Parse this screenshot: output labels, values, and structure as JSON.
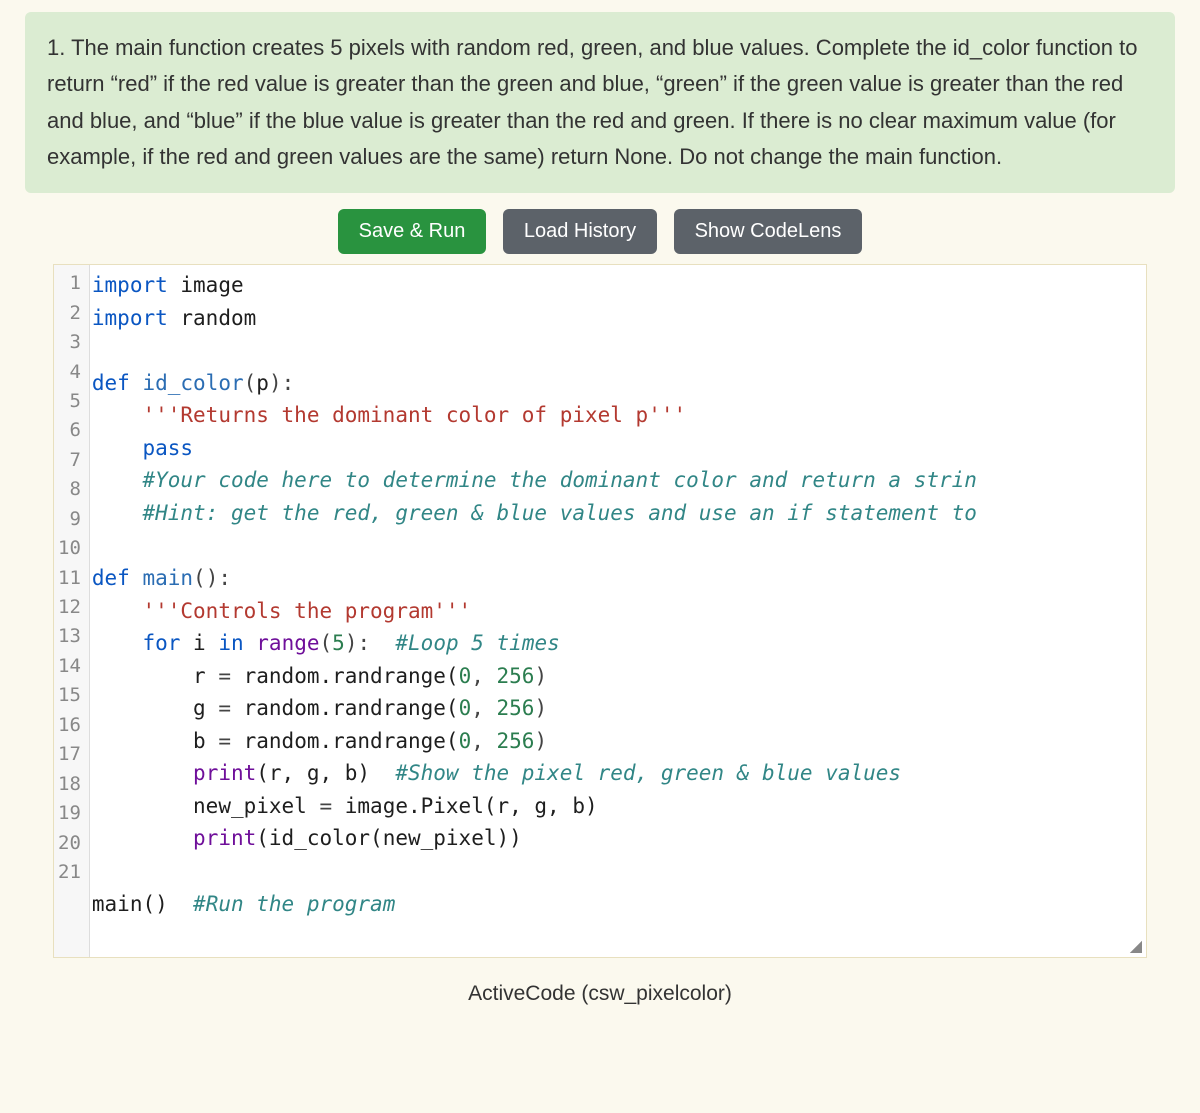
{
  "prompt": "1. The main function creates 5 pixels with random red, green, and blue values. Complete the id_color function to return “red” if the red value is greater than the green and blue, “green” if the green value is greater than the red and blue, and “blue” if the blue value is greater than the red and green. If there is no clear maximum value (for example, if the red and green values are the same) return None. Do not change the main function.",
  "buttons": {
    "save_run": "Save & Run",
    "load_history": "Load History",
    "show_codelens": "Show CodeLens"
  },
  "caption": "ActiveCode (csw_pixelcolor)",
  "code_lines": [
    [
      {
        "t": "import",
        "c": "kw"
      },
      {
        "t": " image",
        "c": "name"
      }
    ],
    [
      {
        "t": "import",
        "c": "kw"
      },
      {
        "t": " random",
        "c": "name"
      }
    ],
    [],
    [
      {
        "t": "def ",
        "c": "kw"
      },
      {
        "t": "id_color",
        "c": "fn"
      },
      {
        "t": "(",
        "c": "punct"
      },
      {
        "t": "p",
        "c": "name"
      },
      {
        "t": "):",
        "c": "punct"
      }
    ],
    [
      {
        "t": "    ",
        "c": "name"
      },
      {
        "t": "'''Returns the dominant color of pixel p'''",
        "c": "str"
      }
    ],
    [
      {
        "t": "    ",
        "c": "name"
      },
      {
        "t": "pass",
        "c": "kw"
      }
    ],
    [
      {
        "t": "    ",
        "c": "name"
      },
      {
        "t": "#Your code here to determine the dominant color and return a strin",
        "c": "cmt"
      }
    ],
    [
      {
        "t": "    ",
        "c": "name"
      },
      {
        "t": "#Hint: get the red, green & blue values and use an if statement to",
        "c": "cmt"
      }
    ],
    [],
    [
      {
        "t": "def ",
        "c": "kw"
      },
      {
        "t": "main",
        "c": "fn"
      },
      {
        "t": "():",
        "c": "punct"
      }
    ],
    [
      {
        "t": "    ",
        "c": "name"
      },
      {
        "t": "'''Controls the program'''",
        "c": "str"
      }
    ],
    [
      {
        "t": "    ",
        "c": "name"
      },
      {
        "t": "for ",
        "c": "kw"
      },
      {
        "t": "i ",
        "c": "name"
      },
      {
        "t": "in ",
        "c": "kw"
      },
      {
        "t": "range",
        "c": "builtin"
      },
      {
        "t": "(",
        "c": "punct"
      },
      {
        "t": "5",
        "c": "num"
      },
      {
        "t": "):  ",
        "c": "punct"
      },
      {
        "t": "#Loop 5 times",
        "c": "cmt"
      }
    ],
    [
      {
        "t": "        r ",
        "c": "name"
      },
      {
        "t": "=",
        "c": "punct"
      },
      {
        "t": " random.randrange(",
        "c": "name"
      },
      {
        "t": "0",
        "c": "num"
      },
      {
        "t": ", ",
        "c": "punct"
      },
      {
        "t": "256",
        "c": "num"
      },
      {
        "t": ")",
        "c": "punct"
      }
    ],
    [
      {
        "t": "        g ",
        "c": "name"
      },
      {
        "t": "=",
        "c": "punct"
      },
      {
        "t": " random.randrange(",
        "c": "name"
      },
      {
        "t": "0",
        "c": "num"
      },
      {
        "t": ", ",
        "c": "punct"
      },
      {
        "t": "256",
        "c": "num"
      },
      {
        "t": ")",
        "c": "punct"
      }
    ],
    [
      {
        "t": "        b ",
        "c": "name"
      },
      {
        "t": "=",
        "c": "punct"
      },
      {
        "t": " random.randrange(",
        "c": "name"
      },
      {
        "t": "0",
        "c": "num"
      },
      {
        "t": ", ",
        "c": "punct"
      },
      {
        "t": "256",
        "c": "num"
      },
      {
        "t": ")",
        "c": "punct"
      }
    ],
    [
      {
        "t": "        ",
        "c": "name"
      },
      {
        "t": "print",
        "c": "builtin"
      },
      {
        "t": "(r, g, b)  ",
        "c": "name"
      },
      {
        "t": "#Show the pixel red, green & blue values",
        "c": "cmt"
      }
    ],
    [
      {
        "t": "        new_pixel ",
        "c": "name"
      },
      {
        "t": "=",
        "c": "punct"
      },
      {
        "t": " image.Pixel(r, g, b)",
        "c": "name"
      }
    ],
    [
      {
        "t": "        ",
        "c": "name"
      },
      {
        "t": "print",
        "c": "builtin"
      },
      {
        "t": "(id_color(new_pixel))",
        "c": "name"
      }
    ],
    [],
    [
      {
        "t": "main()  ",
        "c": "name"
      },
      {
        "t": "#Run the program",
        "c": "cmt"
      }
    ],
    []
  ]
}
